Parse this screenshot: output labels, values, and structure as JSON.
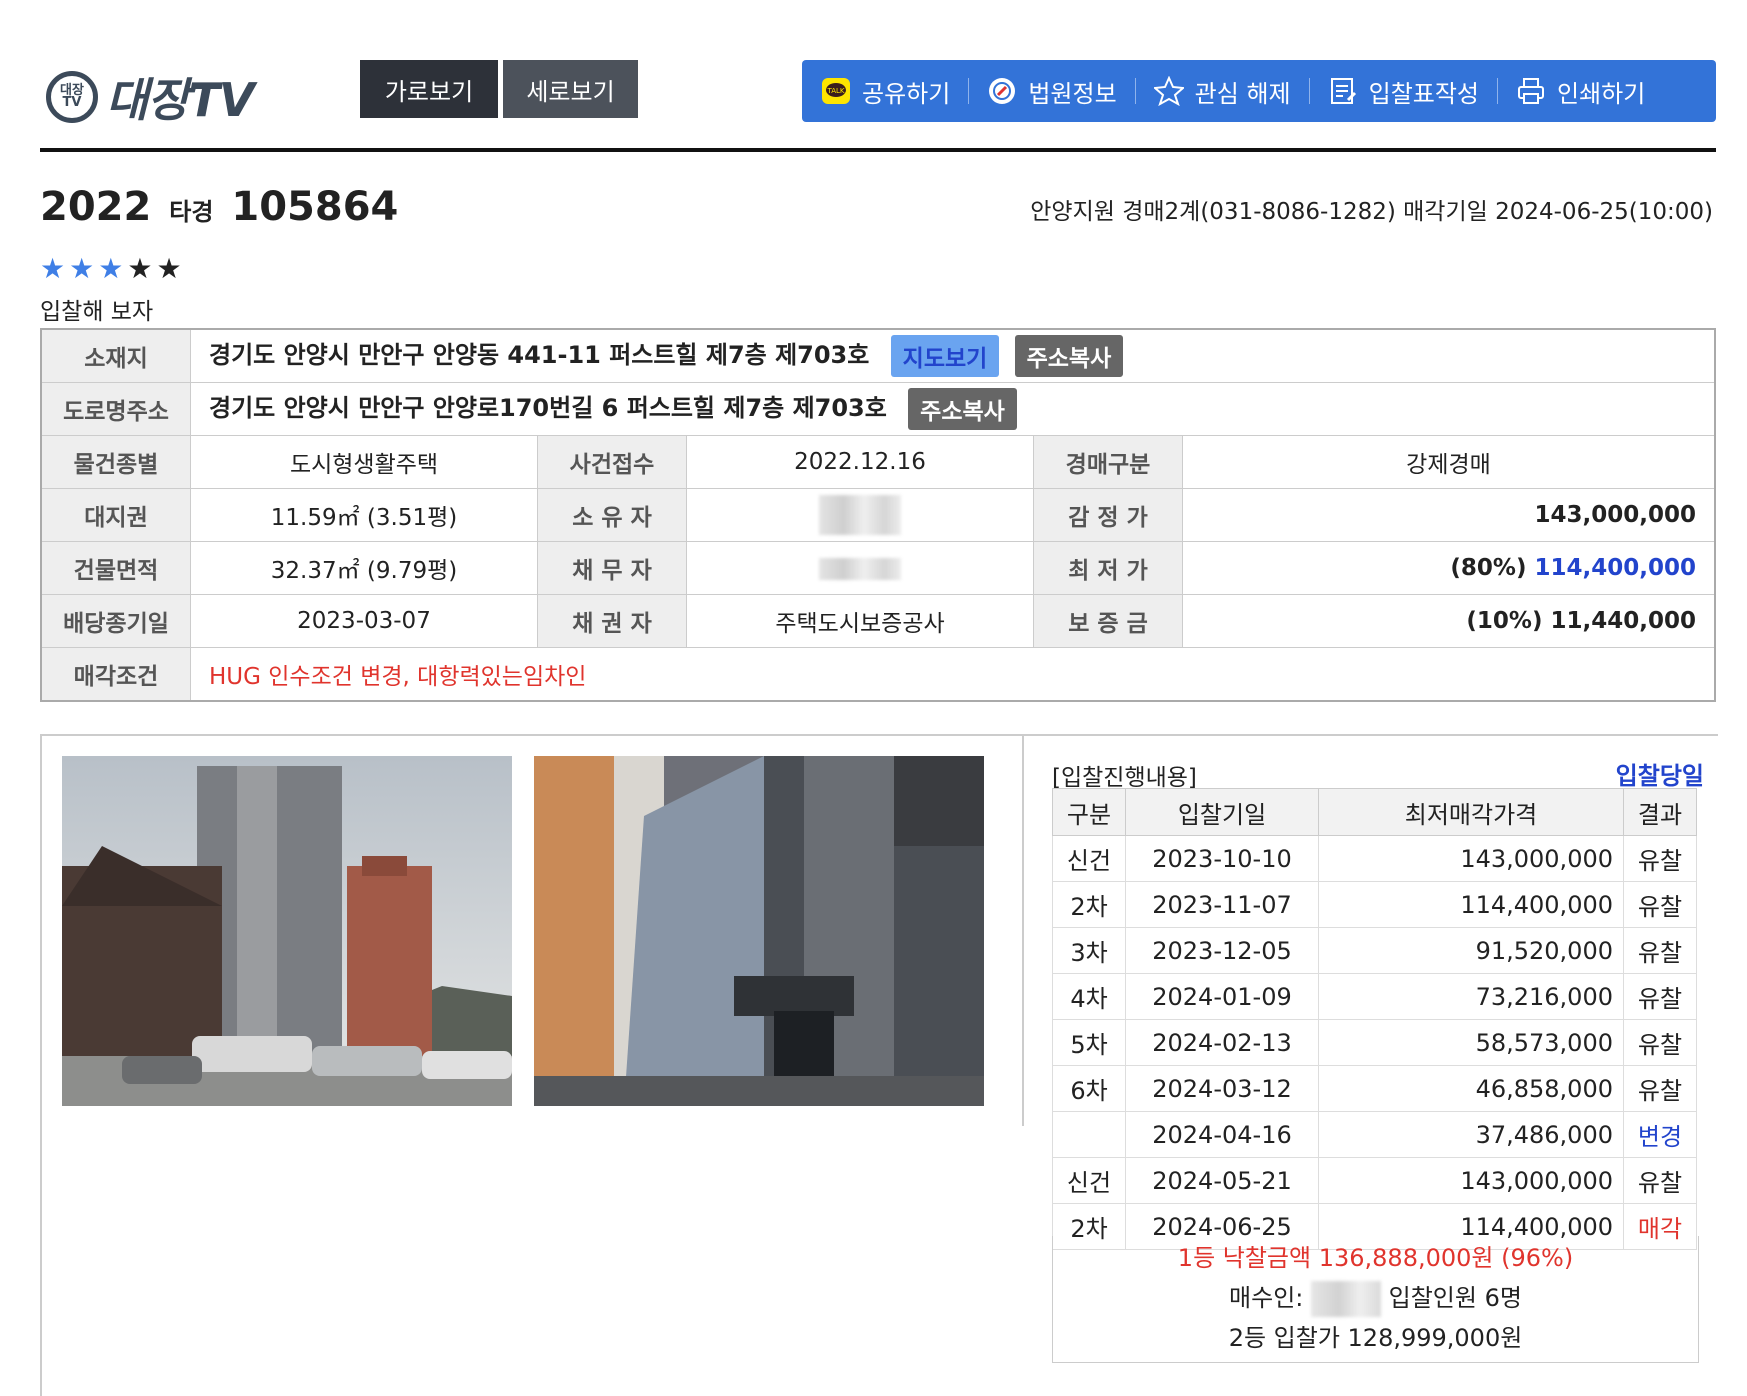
{
  "header": {
    "logo_badge": "대장 TV",
    "logo_text": "대장TV",
    "view_horizontal": "가로보기",
    "view_vertical": "세로보기",
    "tools": [
      {
        "label": "공유하기",
        "icon": "kakao-talk-icon"
      },
      {
        "label": "법원정보",
        "icon": "court-info-icon"
      },
      {
        "label": "관심 해제",
        "icon": "star-outline-icon"
      },
      {
        "label": "입찰표작성",
        "icon": "bid-form-icon"
      },
      {
        "label": "인쇄하기",
        "icon": "printer-icon"
      }
    ],
    "accent_color": "#3373d8"
  },
  "case": {
    "year": "2022",
    "type": "타경",
    "number": "105864",
    "court_info": "안양지원 경매2계(031-8086-1282) 매각기일 2024-06-25(10:00)",
    "rating": 3,
    "rating_max": 5,
    "memo": "입찰해 보자"
  },
  "info": {
    "location_label": "소재지",
    "location": "경기도 안양시 만안구 안양동 441-11 퍼스트힐 제7층 제703호",
    "map_button": "지도보기",
    "copy_button": "주소복사",
    "road_label": "도로명주소",
    "road_address": "경기도 안양시 만안구 안양로170번길 6 퍼스트힐 제7층 제703호",
    "rows": [
      {
        "l1": "물건종별",
        "v1": "도시형생활주택",
        "l2": "사건접수",
        "v2": "2022.12.16",
        "l3": "경매구분",
        "v3": "강제경매"
      },
      {
        "l1": "대지권",
        "v1": "11.59㎡ (3.51평)",
        "l2": "소 유 자",
        "v2": "",
        "l3": "감 정 가",
        "v3": "143,000,000"
      },
      {
        "l1": "건물면적",
        "v1": "32.37㎡ (9.79평)",
        "l2": "채 무 자",
        "v2": "",
        "l3": "최 저 가",
        "v3_pct": "(80%)",
        "v3": "114,400,000"
      },
      {
        "l1": "배당종기일",
        "v1": "2023-03-07",
        "l2": "채 권 자",
        "v2": "주택도시보증공사",
        "l3": "보 증 금",
        "v3_pct": "(10%)",
        "v3": "11,440,000"
      }
    ],
    "condition_label": "매각조건",
    "condition": "HUG 인수조건 변경, 대항력있는임차인"
  },
  "bids": {
    "title": "[입찰진행내용]",
    "day_link": "입찰당일",
    "headers": [
      "구분",
      "입찰기일",
      "최저매각가격",
      "결과"
    ],
    "rows": [
      {
        "round": "신건",
        "date": "2023-10-10",
        "price": "143,000,000",
        "result": "유찰"
      },
      {
        "round": "2차",
        "date": "2023-11-07",
        "price": "114,400,000",
        "result": "유찰"
      },
      {
        "round": "3차",
        "date": "2023-12-05",
        "price": "91,520,000",
        "result": "유찰"
      },
      {
        "round": "4차",
        "date": "2024-01-09",
        "price": "73,216,000",
        "result": "유찰"
      },
      {
        "round": "5차",
        "date": "2024-02-13",
        "price": "58,573,000",
        "result": "유찰"
      },
      {
        "round": "6차",
        "date": "2024-03-12",
        "price": "46,858,000",
        "result": "유찰"
      },
      {
        "round": "",
        "date": "2024-04-16",
        "price": "37,486,000",
        "result": "변경"
      },
      {
        "round": "신건",
        "date": "2024-05-21",
        "price": "143,000,000",
        "result": "유찰"
      },
      {
        "round": "2차",
        "date": "2024-06-25",
        "price": "114,400,000",
        "result": "매각"
      }
    ],
    "winner_line": "1등 낙찰금액 136,888,000원 (96%)",
    "buyer_label": "매수인:",
    "bidders": "입찰인원 6명",
    "second_line": "2등 입찰가 128,999,000원"
  }
}
